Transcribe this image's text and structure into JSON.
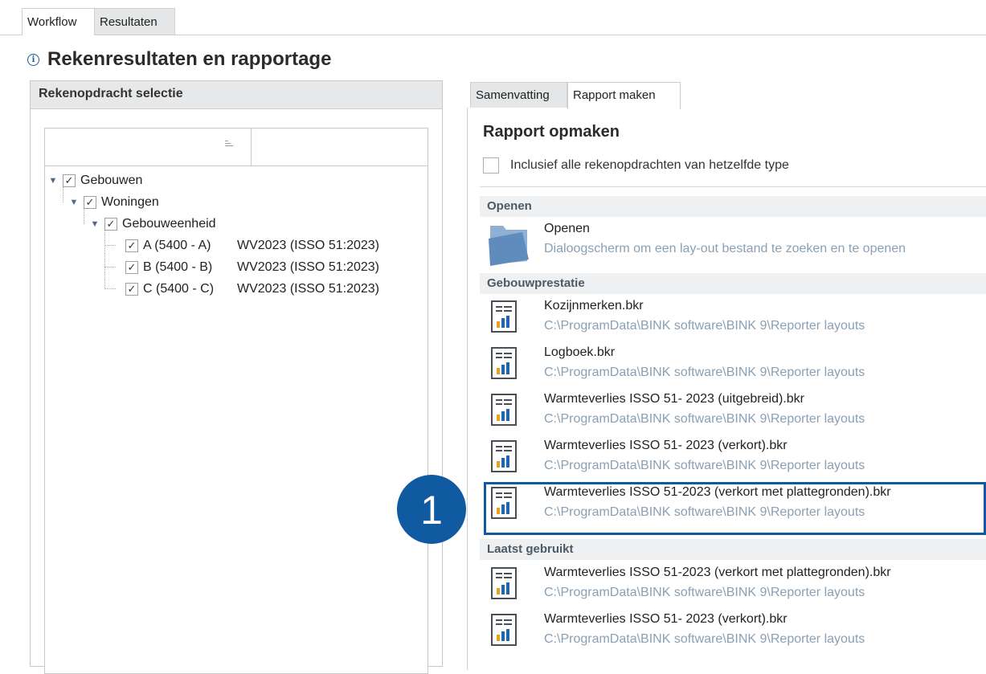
{
  "top_tabs": [
    {
      "label": "Workflow",
      "active": true
    },
    {
      "label": "Resultaten",
      "active": false
    }
  ],
  "page": {
    "title": "Rekenresultaten en rapportage",
    "title_icon": "info-circle-icon"
  },
  "left_panel": {
    "header": "Rekenopdracht selectie",
    "tree": [
      {
        "label": "Gebouwen",
        "checked": true,
        "expanded": true,
        "level": 0,
        "value": ""
      },
      {
        "label": "Woningen",
        "checked": true,
        "expanded": true,
        "level": 1,
        "value": ""
      },
      {
        "label": "Gebouweenheid",
        "checked": true,
        "expanded": true,
        "level": 2,
        "value": ""
      },
      {
        "label": "A (5400 - A)",
        "checked": true,
        "level": 3,
        "value": "WV2023 (ISSO 51:2023)"
      },
      {
        "label": "B (5400 - B)",
        "checked": true,
        "level": 3,
        "value": "WV2023 (ISSO 51:2023)"
      },
      {
        "label": "C (5400 - C)",
        "checked": true,
        "level": 3,
        "value": "WV2023 (ISSO 51:2023)"
      }
    ]
  },
  "right_tabs": [
    {
      "label": "Samenvatting",
      "active": false
    },
    {
      "label": "Rapport maken",
      "active": true
    }
  ],
  "rapport": {
    "title": "Rapport opmaken",
    "include_label": "Inclusief alle rekenopdrachten van hetzelfde type",
    "include_checked": false,
    "groups": {
      "open": {
        "header": "Openen",
        "item": {
          "name": "Openen",
          "desc": "Dialoogscherm om een lay-out bestand te zoeken en te openen",
          "icon": "folder-icon"
        }
      },
      "gebouwprestatie": {
        "header": "Gebouwprestatie",
        "items": [
          {
            "name": "Kozijnmerken.bkr",
            "path": "C:\\ProgramData\\BINK software\\BINK 9\\Reporter layouts"
          },
          {
            "name": "Logboek.bkr",
            "path": "C:\\ProgramData\\BINK software\\BINK 9\\Reporter layouts"
          },
          {
            "name": "Warmteverlies ISSO 51- 2023 (uitgebreid).bkr",
            "path": "C:\\ProgramData\\BINK software\\BINK 9\\Reporter layouts"
          },
          {
            "name": "Warmteverlies ISSO 51- 2023 (verkort).bkr",
            "path": "C:\\ProgramData\\BINK software\\BINK 9\\Reporter layouts"
          },
          {
            "name": "Warmteverlies ISSO 51-2023 (verkort met plattegronden).bkr",
            "path": "C:\\ProgramData\\BINK software\\BINK 9\\Reporter layouts",
            "highlighted": true
          }
        ]
      },
      "recent": {
        "header": "Laatst gebruikt",
        "items": [
          {
            "name": "Warmteverlies ISSO 51-2023 (verkort met plattegronden).bkr",
            "path": "C:\\ProgramData\\BINK software\\BINK 9\\Reporter layouts"
          },
          {
            "name": "Warmteverlies ISSO 51- 2023 (verkort).bkr",
            "path": "C:\\ProgramData\\BINK software\\BINK 9\\Reporter layouts"
          }
        ]
      }
    }
  },
  "callout": {
    "number": "1"
  },
  "colors": {
    "accent": "#0f5aa0",
    "path_text": "#8aa0b4",
    "group_header_bg": "#eef0f2",
    "panel_header_bg": "#e6e8ea"
  }
}
